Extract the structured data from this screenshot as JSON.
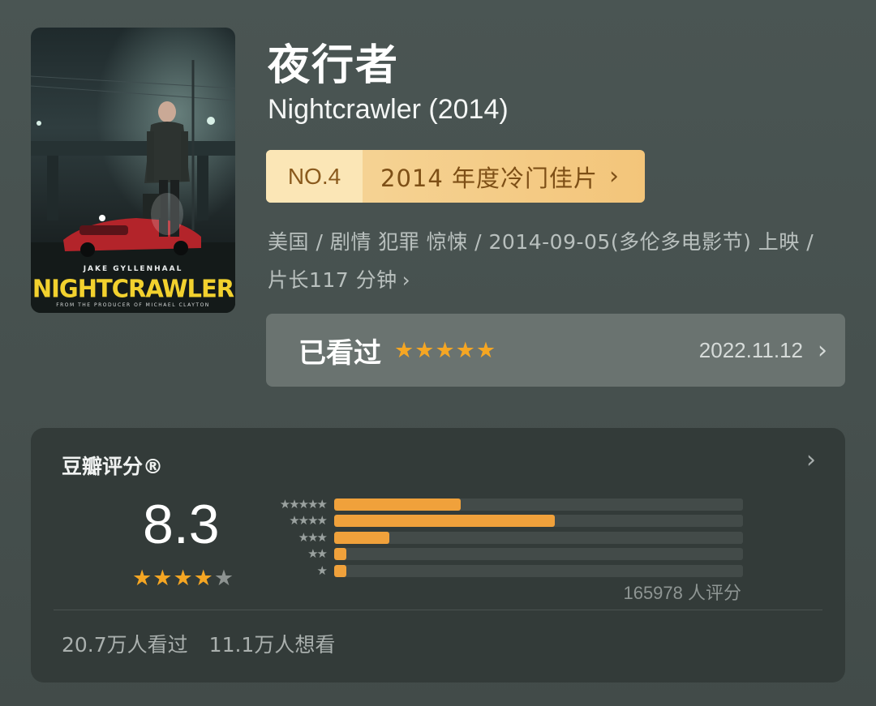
{
  "poster": {
    "actor": "JAKE GYLLENHAAL",
    "title": "NIGHTCRAWLER",
    "tagline": "FROM THE PRODUCER OF MICHAEL CLAYTON"
  },
  "movie": {
    "title_cn": "夜行者",
    "title_en": "Nightcrawler (2014)"
  },
  "rank": {
    "no": "NO.4",
    "list": "2014 年度冷门佳片",
    "chevron": "›"
  },
  "meta": {
    "info": "美国 / 剧情 犯罪 惊悚 / 2014-09-05(多伦多电影节) 上映 / 片长117 分钟",
    "chevron": "›"
  },
  "watched": {
    "label": "已看过",
    "stars": 5,
    "date": "2022.11.12",
    "chevron": "›"
  },
  "rating": {
    "label": "豆瓣评分®",
    "chevron": "›",
    "score": "8.3",
    "stars": 4,
    "count_text": "165978 人评分",
    "distribution": [
      {
        "stars": "★★★★★",
        "fraction": 0.31
      },
      {
        "stars": "★★★★",
        "fraction": 0.54
      },
      {
        "stars": "★★★",
        "fraction": 0.135
      },
      {
        "stars": "★★",
        "fraction": 0.03
      },
      {
        "stars": "★",
        "fraction": 0.03
      }
    ],
    "watched_count": "20.7万人看过",
    "want_count": "11.1万人想看"
  },
  "colors": {
    "accent_star": "#f5a623",
    "bar_fill": "#f0a13b",
    "badge_bg": "#f3c57a"
  }
}
